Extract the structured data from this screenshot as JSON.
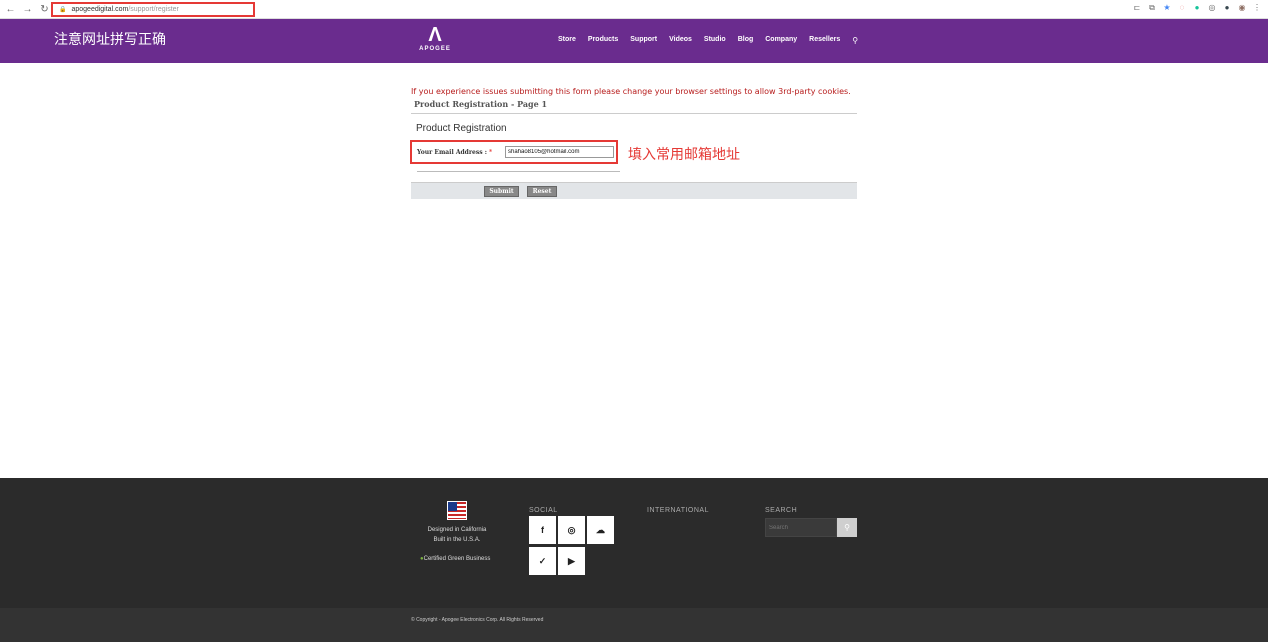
{
  "browser": {
    "back_icon": "←",
    "forward_icon": "→",
    "reload_icon": "↻",
    "url_domain": "apogeedigital.com",
    "url_path": "/support/register",
    "ext_icons": [
      "⊏",
      "⧉",
      "★",
      "◌",
      "●",
      "◎",
      "●",
      "◉",
      "⋮"
    ]
  },
  "header": {
    "annotation_url": "注意网址拼写正确",
    "logo_text": "APOGEE",
    "menu": [
      "Store",
      "Products",
      "Support",
      "Videos",
      "Studio",
      "Blog",
      "Company",
      "Resellers"
    ],
    "search_icon": "🔍"
  },
  "content": {
    "warning": "If you experience issues submitting this form please change your browser settings to allow 3rd-party cookies.",
    "page_heading": "Product Registration - Page 1",
    "form_title": "Product Registration",
    "email_label": "Your Email Address :",
    "required_mark": "*",
    "email_value": "shahao8105@hotmail.com",
    "annotation_email": "填入常用邮箱地址",
    "submit_label": "Submit",
    "reset_label": "Reset"
  },
  "footer": {
    "designed_line1": "Designed in California",
    "designed_line2": "Built in the U.S.A.",
    "green_text": "Certified Green Business",
    "social_heading": "SOCIAL",
    "international_heading": "INTERNATIONAL",
    "search_heading": "SEARCH",
    "search_placeholder": "Search",
    "copyright": "© Copyright - Apogee Electronics Corp. All Rights Reserved"
  }
}
